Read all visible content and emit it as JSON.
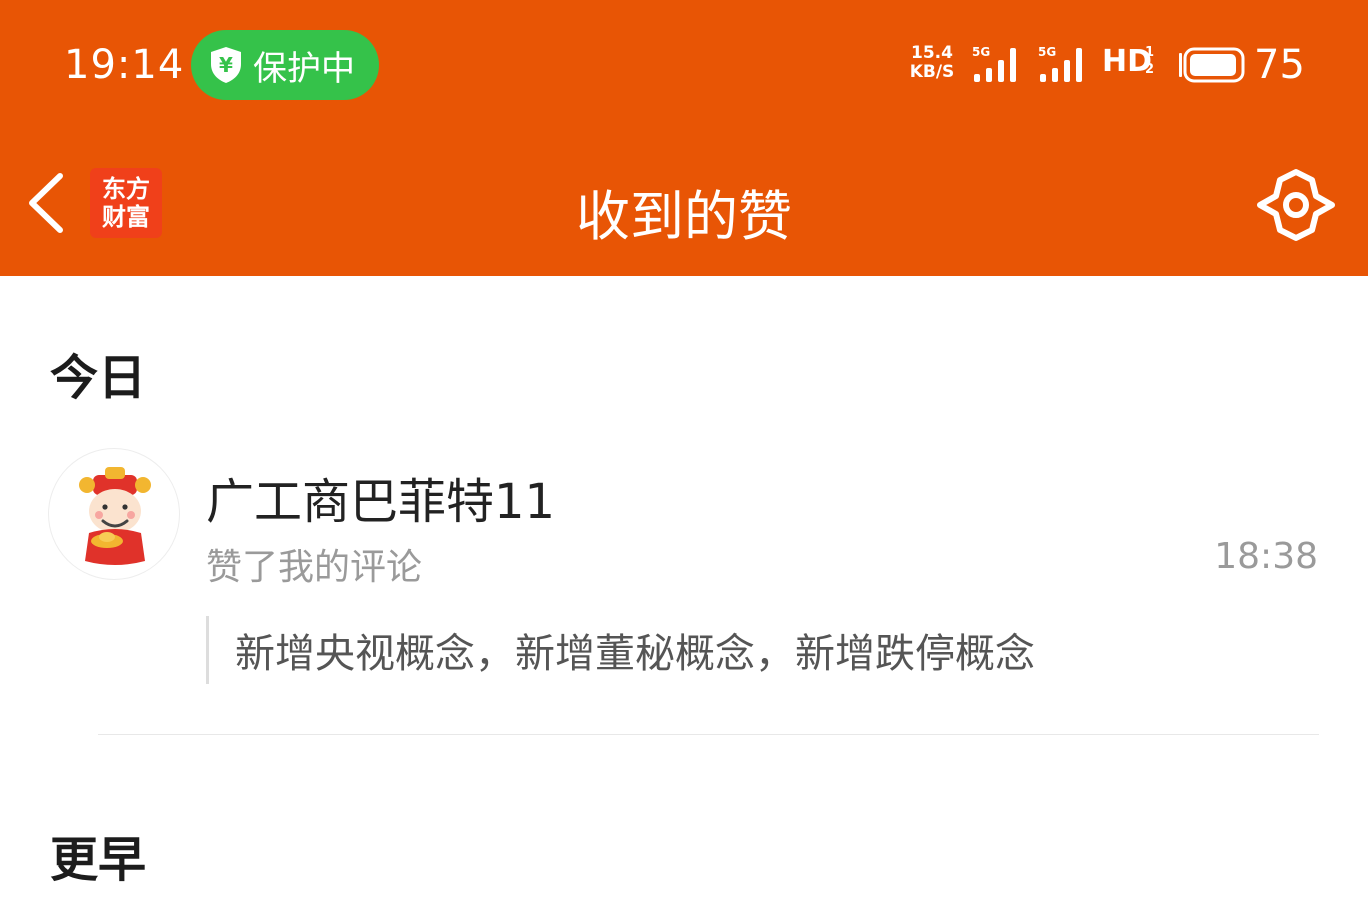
{
  "status_bar": {
    "time": "19:14",
    "protect_label": "保护中",
    "net_speed_value": "15.4",
    "net_speed_unit": "KB/S",
    "signal_1_label": "5G",
    "signal_2_label": "5G",
    "hd_label": "HD",
    "hd_sub_1": "1",
    "hd_sub_2": "2",
    "battery_level": "75",
    "icons": [
      "shield-yuan-icon",
      "signal-5g-icon",
      "signal-5g-icon",
      "battery-icon"
    ]
  },
  "nav": {
    "back_icon": "chevron-left-icon",
    "logo_line1": "东方",
    "logo_line2": "财富",
    "title": "收到的赞",
    "settings_icon": "gear-icon"
  },
  "sections": {
    "today": {
      "title": "今日",
      "items": [
        {
          "user_name": "广工商巴菲特11",
          "action": "赞了我的评论",
          "time": "18:38",
          "quote": "新增央视概念，新增董秘概念，新增跌停概念"
        }
      ]
    },
    "earlier": {
      "title": "更早"
    }
  },
  "colors": {
    "header_bg": "#E85505",
    "protect_pill": "#35C24A",
    "logo_bg": "#F0401A",
    "secondary_text": "#9A9A9A"
  }
}
